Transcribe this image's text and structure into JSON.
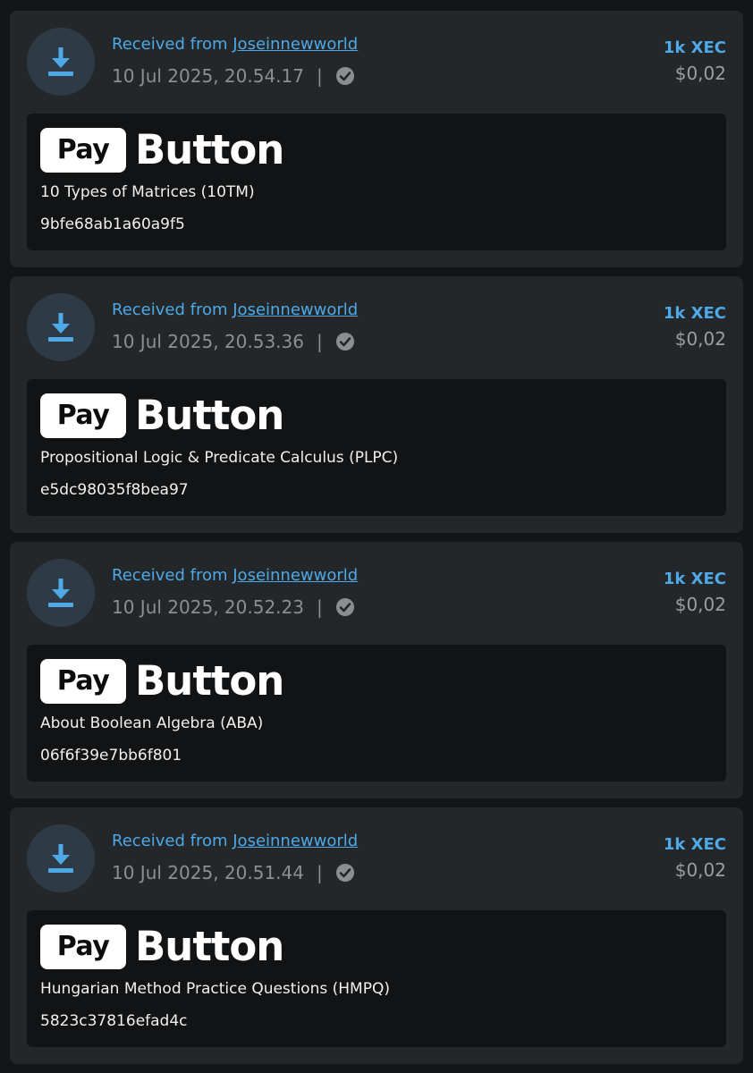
{
  "transactions": [
    {
      "received_prefix": "Received from",
      "sender": "Joseinnewworld",
      "date": "10 Jul 2025, 20.54.17",
      "separator": "|",
      "amount_xec": "1k XEC",
      "amount_fiat": "$0,02",
      "brand_pay": "Pay",
      "brand_button": "Button",
      "title": "10 Types of Matrices (10TM)",
      "hash": "9bfe68ab1a60a9f5"
    },
    {
      "received_prefix": "Received from",
      "sender": "Joseinnewworld",
      "date": "10 Jul 2025, 20.53.36",
      "separator": "|",
      "amount_xec": "1k XEC",
      "amount_fiat": "$0,02",
      "brand_pay": "Pay",
      "brand_button": "Button",
      "title": "Propositional Logic & Predicate Calculus (PLPC)",
      "hash": "e5dc98035f8bea97"
    },
    {
      "received_prefix": "Received from",
      "sender": "Joseinnewworld",
      "date": "10 Jul 2025, 20.52.23",
      "separator": "|",
      "amount_xec": "1k XEC",
      "amount_fiat": "$0,02",
      "brand_pay": "Pay",
      "brand_button": "Button",
      "title": "About Boolean Algebra (ABA)",
      "hash": "06f6f39e7bb6f801"
    },
    {
      "received_prefix": "Received from",
      "sender": "Joseinnewworld",
      "date": "10 Jul 2025, 20.51.44",
      "separator": "|",
      "amount_xec": "1k XEC",
      "amount_fiat": "$0,02",
      "brand_pay": "Pay",
      "brand_button": "Button",
      "title": "Hungarian Method Practice Questions (HMPQ)",
      "hash": "5823c37816efad4c"
    }
  ],
  "icons": {
    "receive": "download-icon",
    "status": "check-circle-icon"
  },
  "colors": {
    "accent": "#4ea9e6",
    "card_bg": "#23272a",
    "panel_bg": "#121314",
    "page_bg": "#131516",
    "muted": "#8b8f92"
  }
}
